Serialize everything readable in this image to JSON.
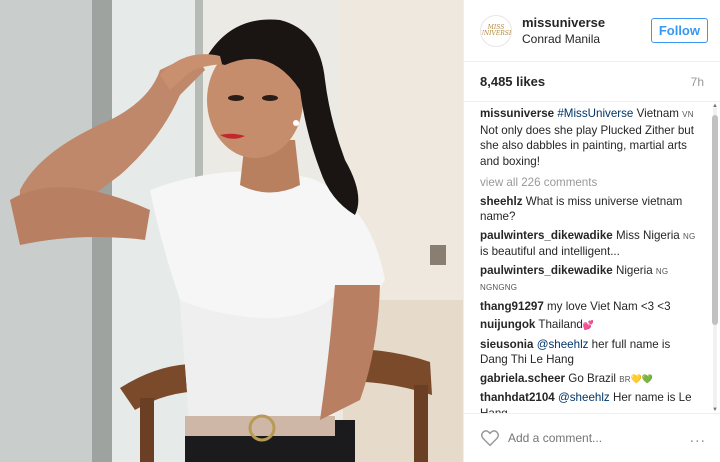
{
  "post": {
    "account": {
      "username": "missuniverse",
      "location": "Conrad Manila",
      "avatar_text": "MISS UNIVERSE",
      "follow_label": "Follow"
    },
    "likes": "8,485 likes",
    "time": "7h",
    "caption": {
      "username": "missuniverse",
      "hashtag": "#MissUniverse",
      "text_1": " Vietnam ",
      "country_code": "VN",
      "text_2": " Not only does she play Plucked Zither but she also dabbles in painting, martial arts and boxing!"
    },
    "view_all": "view all 226 comments",
    "comments": [
      {
        "user": "sheehlz",
        "text": " What is miss universe vietnam name?"
      },
      {
        "user": "paulwinters_dikewadike",
        "text": " Miss Nigeria ",
        "code": "NG",
        "text2": " is beautiful and intelligent..."
      },
      {
        "user": "paulwinters_dikewadike",
        "text": " Nigeria ",
        "code": "NG NGNGNG",
        "text2": ""
      },
      {
        "user": "thang91297",
        "text": " my love Viet Nam <3 <3"
      },
      {
        "user": "nuijungok",
        "text": " Thailand",
        "emoji": "💕"
      },
      {
        "user": "sieusonia",
        "mention": "@sheehlz",
        "text": " her full name is Dang Thi Le Hang"
      },
      {
        "user": "gabriela.scheer",
        "text": " Go Brazil ",
        "code": "BR",
        "emoji": "💛💚"
      },
      {
        "user": "thanhdat2104",
        "mention": "@sheehlz",
        "text": " Her name is Le Hang"
      }
    ],
    "add_comment_placeholder": "Add a comment...",
    "more_icon": "..."
  },
  "colors": {
    "accent": "#3897f0",
    "hashtag": "#003569",
    "muted": "#999999"
  },
  "icons": {
    "heart": "heart-outline-icon",
    "more": "ellipsis-icon"
  }
}
